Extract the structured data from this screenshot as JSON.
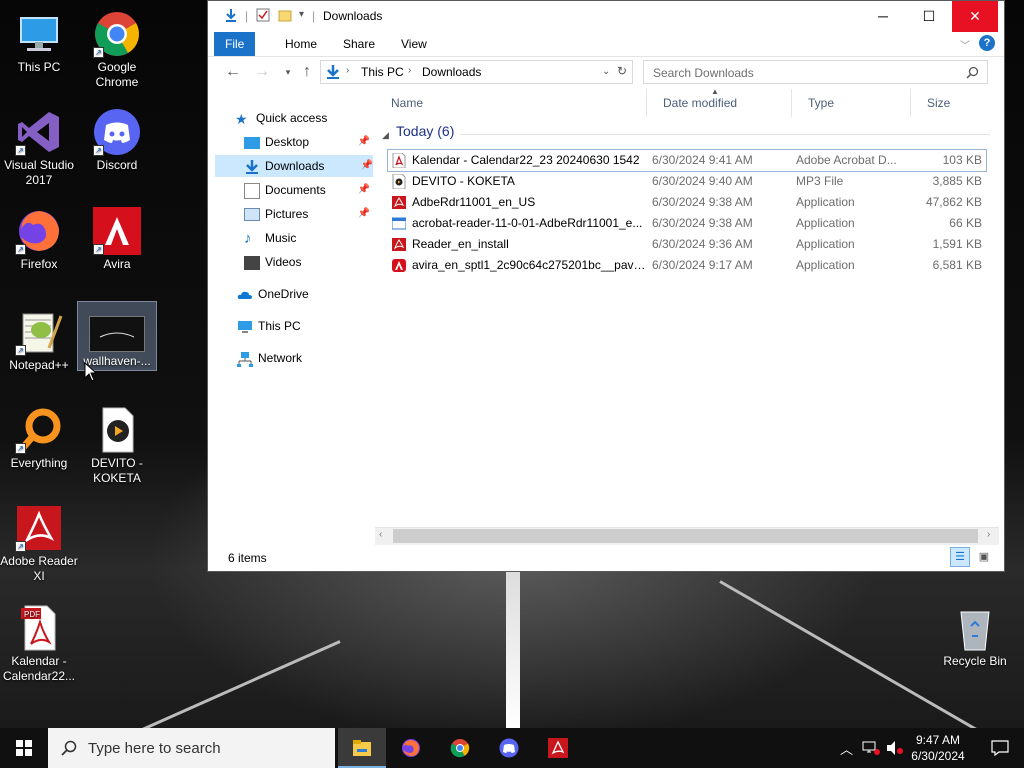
{
  "desktop": {
    "icons": [
      {
        "label": "This PC"
      },
      {
        "label": "Google Chrome"
      },
      {
        "label": "Visual Studio 2017"
      },
      {
        "label": "Discord"
      },
      {
        "label": "Firefox"
      },
      {
        "label": "Avira"
      },
      {
        "label": "Notepad++"
      },
      {
        "label": "wallhaven-..."
      },
      {
        "label": "Everything"
      },
      {
        "label": "DEVITO - KOKETA"
      },
      {
        "label": "Adobe Reader XI"
      },
      {
        "label": "Kalendar - Calendar22..."
      },
      {
        "label": "Recycle Bin"
      }
    ]
  },
  "explorer": {
    "title": "Downloads",
    "ribbon_tabs": [
      "File",
      "Home",
      "Share",
      "View"
    ],
    "help": "?",
    "breadcrumb": [
      "This PC",
      "Downloads"
    ],
    "search_placeholder": "Search Downloads",
    "nav": {
      "quick_access": "Quick access",
      "desktop": "Desktop",
      "downloads": "Downloads",
      "documents": "Documents",
      "pictures": "Pictures",
      "music": "Music",
      "videos": "Videos",
      "onedrive": "OneDrive",
      "this_pc": "This PC",
      "network": "Network"
    },
    "columns": [
      "Name",
      "Date modified",
      "Type",
      "Size"
    ],
    "group_label": "Today (6)",
    "files": [
      {
        "name": "Kalendar - Calendar22_23 20240630 1542",
        "date": "6/30/2024 9:41 AM",
        "type": "Adobe Acrobat D...",
        "size": "103 KB",
        "icon": "pdf-file-icon"
      },
      {
        "name": "DEVITO - KOKETA",
        "date": "6/30/2024 9:40 AM",
        "type": "MP3 File",
        "size": "3,885 KB",
        "icon": "mp3-file-icon"
      },
      {
        "name": "AdbeRdr11001_en_US",
        "date": "6/30/2024 9:38 AM",
        "type": "Application",
        "size": "47,862 KB",
        "icon": "adobe-installer-icon"
      },
      {
        "name": "acrobat-reader-11-0-01-AdbeRdr11001_e...",
        "date": "6/30/2024 9:38 AM",
        "type": "Application",
        "size": "66 KB",
        "icon": "app-window-icon"
      },
      {
        "name": "Reader_en_install",
        "date": "6/30/2024 9:36 AM",
        "type": "Application",
        "size": "1,591 KB",
        "icon": "adobe-reader-icon"
      },
      {
        "name": "avira_en_sptl1_2c90c64c275201bc__pavw...",
        "date": "6/30/2024 9:17 AM",
        "type": "Application",
        "size": "6,581 KB",
        "icon": "avira-icon"
      }
    ],
    "status": "6 items"
  },
  "taskbar": {
    "search_placeholder": "Type here to search",
    "time": "9:47 AM",
    "date": "6/30/2024"
  },
  "colors": {
    "accent": "#1a73c8",
    "selection": "#cce8ff",
    "group_header": "#1e3287",
    "adobe_red": "#c8161d"
  }
}
